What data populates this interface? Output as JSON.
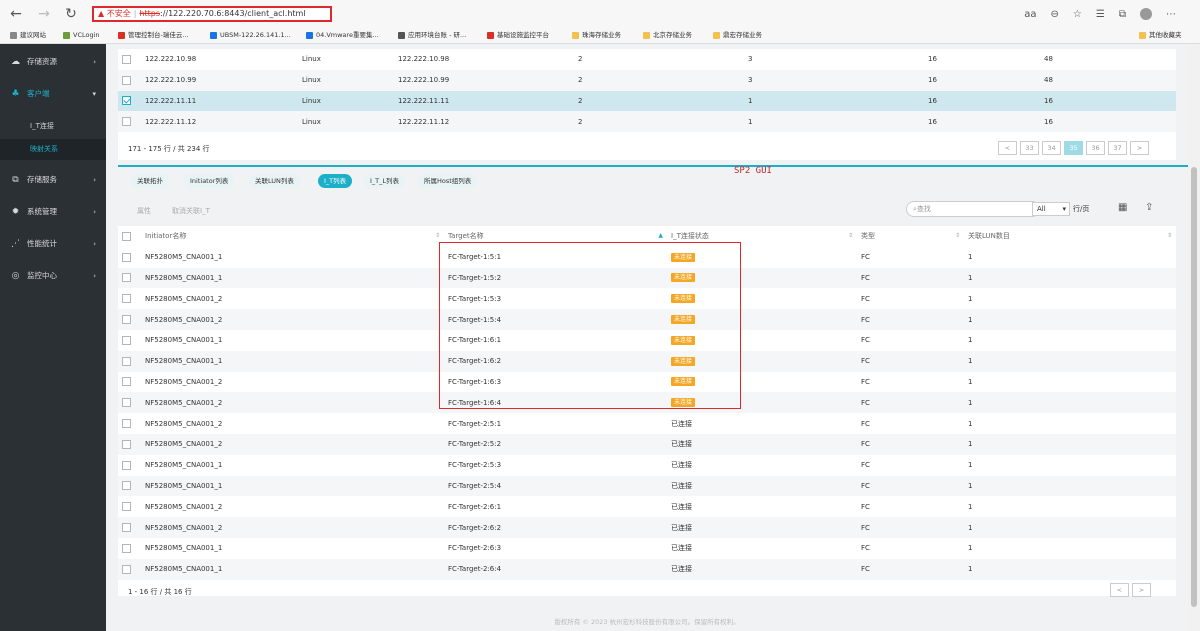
{
  "browser": {
    "security": "不安全",
    "url_scheme": "https",
    "url_rest": "://122.220.70.6:8443/client_acl.html",
    "zoom_icon": "aa",
    "bookmarks": [
      "建议网站",
      "VCLogin",
      "管理控制台-瑞佳云...",
      "UBSM-122.26.141.1...",
      "04.Vmware重要集...",
      "应用环境台账 - 研...",
      "基础设施监控平台",
      "珠海存储业务",
      "北京存储业务",
      "鼎宏存储业务"
    ],
    "other_bookmarks": "其他收藏夹"
  },
  "sidebar": {
    "items": [
      {
        "label": "存储资源",
        "icon": "cloud-icon"
      },
      {
        "label": "客户端",
        "icon": "org-icon"
      },
      {
        "label": "存储服务",
        "icon": "service-icon"
      },
      {
        "label": "系统管理",
        "icon": "gear-icon"
      },
      {
        "label": "性能统计",
        "icon": "stats-icon"
      },
      {
        "label": "监控中心",
        "icon": "monitor-icon"
      }
    ],
    "sub_items": [
      "I_T连接",
      "映射关系"
    ]
  },
  "top_table": {
    "rows": [
      [
        "122.222.10.98",
        "Linux",
        "122.222.10.98",
        "2",
        "3",
        "16",
        "48"
      ],
      [
        "122.222.10.99",
        "Linux",
        "122.222.10.99",
        "2",
        "3",
        "16",
        "48"
      ],
      [
        "122.222.11.11",
        "Linux",
        "122.222.11.11",
        "2",
        "1",
        "16",
        "16"
      ],
      [
        "122.222.11.12",
        "Linux",
        "122.222.11.12",
        "2",
        "1",
        "16",
        "16"
      ]
    ],
    "info": "171 - 175 行 / 共 234 行",
    "pages": [
      "<",
      "33",
      "34",
      "35",
      "36",
      "37",
      ">"
    ]
  },
  "tabs": [
    "关联拓扑",
    "Initiator列表",
    "关联LUN列表",
    "I_T列表",
    "I_T_L列表",
    "所属Host组列表"
  ],
  "annotation": "SP2 GUI",
  "actions": {
    "attr": "属性",
    "cancel_link": "取消关联I_T"
  },
  "search": {
    "placeholder": "查找"
  },
  "filter": {
    "all": "All",
    "per_page": "行/页"
  },
  "bottom_table": {
    "headers": [
      "Initiator名称",
      "Target名称",
      "I_T连接状态",
      "类型",
      "关联LUN数目"
    ],
    "rows": [
      [
        "NF5280M5_CNA001_1",
        "FC-Target-1:5:1",
        "未连接",
        "FC",
        "1"
      ],
      [
        "NF5280M5_CNA001_1",
        "FC-Target-1:5:2",
        "未连接",
        "FC",
        "1"
      ],
      [
        "NF5280M5_CNA001_2",
        "FC-Target-1:5:3",
        "未连接",
        "FC",
        "1"
      ],
      [
        "NF5280M5_CNA001_2",
        "FC-Target-1:5:4",
        "未连接",
        "FC",
        "1"
      ],
      [
        "NF5280M5_CNA001_1",
        "FC-Target-1:6:1",
        "未连接",
        "FC",
        "1"
      ],
      [
        "NF5280M5_CNA001_1",
        "FC-Target-1:6:2",
        "未连接",
        "FC",
        "1"
      ],
      [
        "NF5280M5_CNA001_2",
        "FC-Target-1:6:3",
        "未连接",
        "FC",
        "1"
      ],
      [
        "NF5280M5_CNA001_2",
        "FC-Target-1:6:4",
        "未连接",
        "FC",
        "1"
      ],
      [
        "NF5280M5_CNA001_2",
        "FC-Target-2:5:1",
        "已连接",
        "FC",
        "1"
      ],
      [
        "NF5280M5_CNA001_2",
        "FC-Target-2:5:2",
        "已连接",
        "FC",
        "1"
      ],
      [
        "NF5280M5_CNA001_1",
        "FC-Target-2:5:3",
        "已连接",
        "FC",
        "1"
      ],
      [
        "NF5280M5_CNA001_1",
        "FC-Target-2:5:4",
        "已连接",
        "FC",
        "1"
      ],
      [
        "NF5280M5_CNA001_2",
        "FC-Target-2:6:1",
        "已连接",
        "FC",
        "1"
      ],
      [
        "NF5280M5_CNA001_2",
        "FC-Target-2:6:2",
        "已连接",
        "FC",
        "1"
      ],
      [
        "NF5280M5_CNA001_1",
        "FC-Target-2:6:3",
        "已连接",
        "FC",
        "1"
      ],
      [
        "NF5280M5_CNA001_1",
        "FC-Target-2:6:4",
        "已连接",
        "FC",
        "1"
      ]
    ],
    "info": "1 - 16 行 / 共 16 行",
    "pages": [
      "<",
      ">"
    ]
  },
  "footer": "版权所有 © 2023 杭州宏杉科技股份有限公司。保留所有权利。",
  "colors": {
    "accent": "#1cb0c8",
    "warning": "#f5a623",
    "sidebar": "#2b3035",
    "alert": "#e0272b"
  }
}
